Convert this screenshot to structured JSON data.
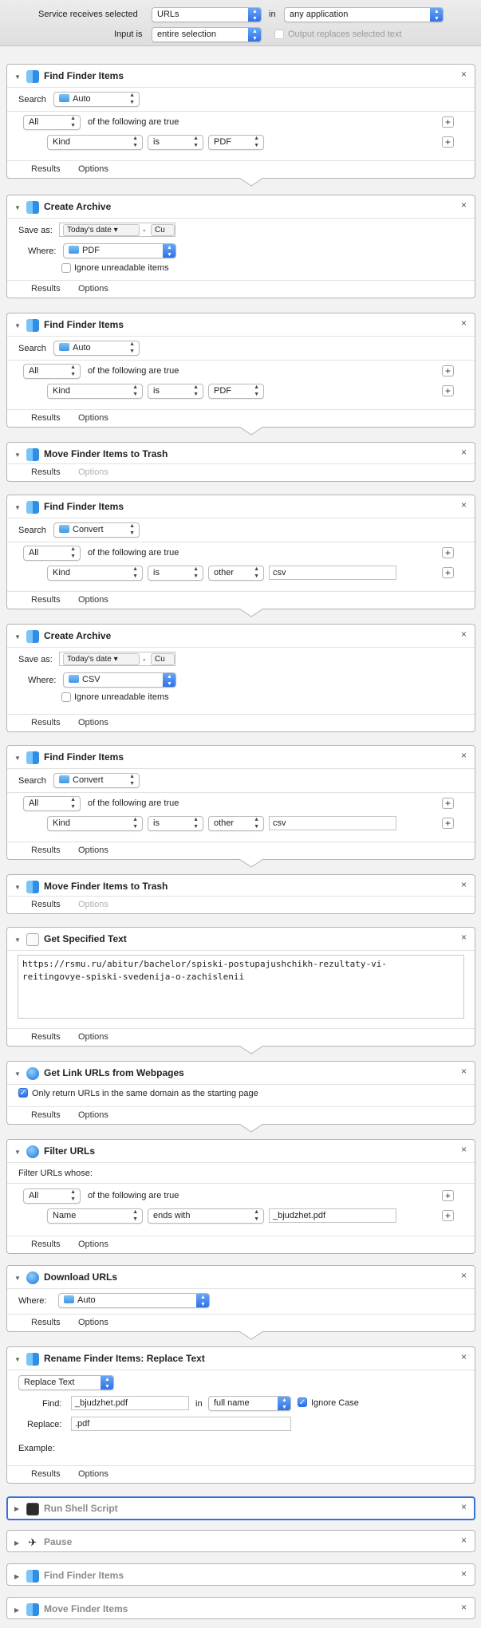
{
  "header": {
    "service_label": "Service receives selected",
    "service_value": "URLs",
    "in_label": "in",
    "in_value": "any application",
    "input_label": "Input is",
    "input_value": "entire selection",
    "output_label": "Output replaces selected text"
  },
  "common": {
    "results": "Results",
    "options": "Options",
    "close": "×",
    "search": "Search",
    "all": "All",
    "following": "of the following are true",
    "kind": "Kind",
    "is": "is",
    "save_as": "Save as:",
    "where": "Where:",
    "ignore": "Ignore unreadable items",
    "todays_date": "Today's date",
    "dash": "-",
    "cut": "Cu",
    "plus": "+"
  },
  "actions": [
    {
      "title": "Find Finder Items",
      "search_in": "Auto",
      "kind_value": "PDF"
    },
    {
      "title": "Create Archive",
      "where": "PDF"
    },
    {
      "title": "Find Finder Items",
      "search_in": "Auto",
      "kind_value": "PDF"
    },
    {
      "title": "Move Finder Items to Trash"
    },
    {
      "title": "Find Finder Items",
      "search_in": "Convert",
      "kind_value": "other",
      "ext": "csv"
    },
    {
      "title": "Create Archive",
      "where": "CSV"
    },
    {
      "title": "Find Finder Items",
      "search_in": "Convert",
      "kind_value": "other",
      "ext": "csv"
    },
    {
      "title": "Move Finder Items to Trash"
    },
    {
      "title": "Get Specified Text",
      "text_line1": "https://rsmu.ru/abitur/bachelor/spiski-postupajushchikh-rezultaty-vi-",
      "text_line2": "reitingovye-spiski-svedenija-o-zachislenii"
    },
    {
      "title": "Get Link URLs from Webpages",
      "check": "Only return URLs in the same domain as the starting page"
    },
    {
      "title": "Filter URLs",
      "whose": "Filter URLs whose:",
      "name": "Name",
      "op": "ends with",
      "value": "_bjudzhet.pdf"
    },
    {
      "title": "Download URLs",
      "where": "Auto"
    },
    {
      "title": "Rename Finder Items: Replace Text",
      "mode": "Replace Text",
      "find_label": "Find:",
      "find_value": "_bjudzhet.pdf",
      "in_label": "in",
      "in_value": "full name",
      "ignore_case": "Ignore Case",
      "replace_label": "Replace:",
      "replace_value": ".pdf",
      "example_label": "Example:"
    },
    {
      "title": "Run Shell Script"
    },
    {
      "title": "Pause"
    },
    {
      "title": "Find Finder Items"
    },
    {
      "title": "Move Finder Items"
    }
  ]
}
